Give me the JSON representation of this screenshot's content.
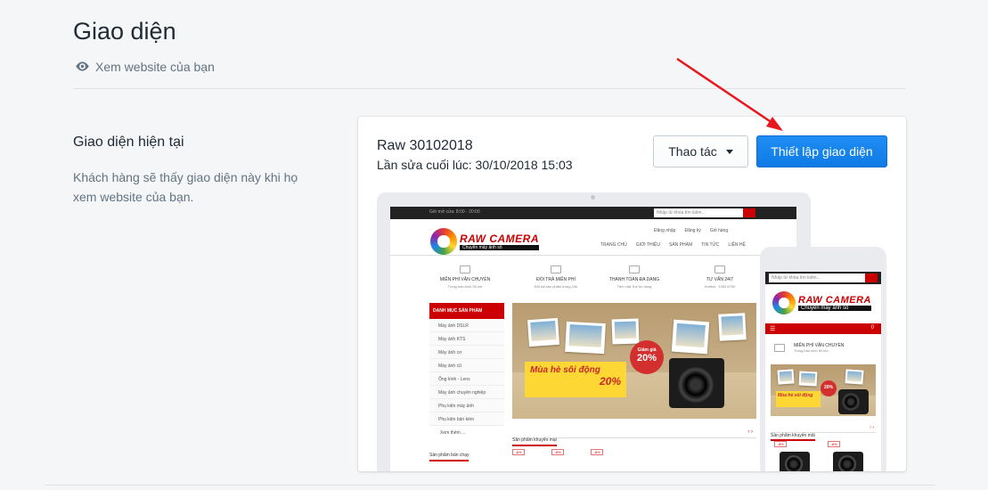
{
  "page": {
    "title": "Giao diện",
    "view_site": "Xem website của bạn"
  },
  "current_theme": {
    "heading": "Giao diện hiện tại",
    "description": "Khách hàng sẽ thấy giao diện này khi họ xem website của bạn."
  },
  "theme_card": {
    "name": "Raw 30102018",
    "last_edited": "Lần sửa cuối lúc: 30/10/2018 15:03",
    "actions_label": "Thao tác",
    "customize_label": "Thiết lập giao diện"
  },
  "preview": {
    "desktop": {
      "open_hours": "Giờ mở cửa: 8:00 - 20:00",
      "search_placeholder": "Nhập từ khóa tìm kiếm...",
      "brand": "RAW CAMERA",
      "slogan": "Chuyên máy ảnh số",
      "user_links": [
        "Đăng nhập",
        "Đăng ký",
        "Giỏ hàng"
      ],
      "nav": [
        "TRANG CHỦ",
        "GIỚI THIỆU",
        "SẢN PHẨM",
        "TIN TỨC",
        "LIÊN HỆ"
      ],
      "features": [
        {
          "title": "MIỄN PHÍ VẬN CHUYỂN",
          "desc": "Trong bán kính 50 km"
        },
        {
          "title": "ĐỔI TRẢ MIỄN PHÍ",
          "desc": "Đổi trả sản phẩm trong 24h"
        },
        {
          "title": "THANH TOÁN ĐA DẠNG",
          "desc": "Tiền mặt, thẻ tín dụng"
        },
        {
          "title": "TƯ VẤN 24/7",
          "desc": "Hotline : 1900 6750"
        }
      ],
      "sidebar_title": "DANH MỤC SẢN PHẨM",
      "sidebar_items": [
        "Máy ảnh DSLR",
        "Máy ảnh KTS",
        "Máy ảnh cơ",
        "Máy ảnh cũ",
        "Ống kính - Lens",
        "Máy ảnh chuyên nghiệp",
        "Phụ kiện máy ảnh",
        "Phụ kiện bán kèm"
      ],
      "sidebar_more": "Xem thêm ...",
      "sidebar_bottom": "Sản phẩm bán chạy",
      "banner_sale_top": "Giảm giá",
      "banner_sale_pct": "20%",
      "banner_promo": "Mùa hè sôi động",
      "banner_promo_pct": "20%",
      "section_title": "Sản phẩm khuyến mại",
      "tag": "-8%"
    },
    "mobile": {
      "search_placeholder": "Nhập từ khóa tìm kiếm...",
      "brand": "RAW CAMERA",
      "slogan": "Chuyên máy ảnh số",
      "feature_title": "MIỄN PHÍ VẬN CHUYỂN",
      "feature_desc": "Trong bán kính 50 km",
      "section_title": "Sản phẩm khuyến mãi",
      "tag": "-8%",
      "cart_count": "0"
    }
  },
  "colors": {
    "primary": "#1f8df3",
    "annotation_arrow": "#e8191e",
    "brand_red": "#cc0000"
  }
}
